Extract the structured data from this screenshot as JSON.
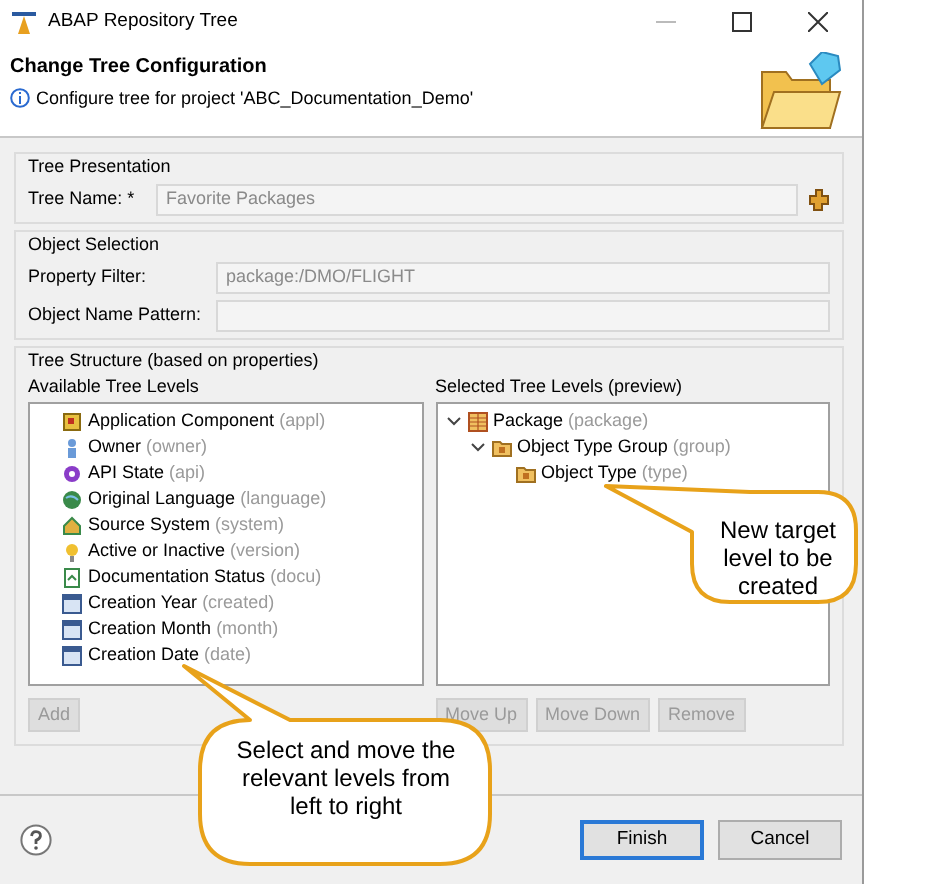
{
  "window": {
    "title": "ABAP Repository Tree"
  },
  "header": {
    "title": "Change Tree Configuration",
    "message": "Configure tree for project 'ABC_Documentation_Demo'"
  },
  "tree_presentation": {
    "legend": "Tree Presentation",
    "label": "Tree Name: *",
    "value": "Favorite Packages"
  },
  "object_selection": {
    "legend": "Object Selection",
    "fields": [
      {
        "label": "Property Filter:",
        "value": "package:/DMO/FLIGHT"
      },
      {
        "label": "Object Name Pattern:"
      }
    ]
  },
  "tree_structure": {
    "legend": "Tree Structure (based on properties)",
    "available": {
      "heading": "Available Tree Levels",
      "items": [
        {
          "name": "Application Component",
          "key": "(appl)"
        },
        {
          "name": "Owner",
          "key": "(owner)"
        },
        {
          "name": "API State",
          "key": "(api)"
        },
        {
          "name": "Original Language",
          "key": "(language)"
        },
        {
          "name": "Source System",
          "key": "(system)"
        },
        {
          "name": "Active or Inactive",
          "key": "(version)"
        },
        {
          "name": "Documentation Status",
          "key": "(docu)"
        },
        {
          "name": "Creation Year",
          "key": "(created)"
        },
        {
          "name": "Creation Month",
          "key": "(month)"
        },
        {
          "name": "Creation Date",
          "key": "(date)"
        }
      ]
    },
    "selected": {
      "heading": "Selected Tree Levels (preview)",
      "items": [
        {
          "name": "Package",
          "key": "(package)",
          "expanded": true,
          "children": [
            {
              "name": "Object Type Group",
              "key": "(group)",
              "expanded": true,
              "children": [
                {
                  "name": "Object Type",
                  "key": "(type)"
                }
              ]
            }
          ]
        }
      ]
    },
    "left_buttons": [
      {
        "label": "Add",
        "disabled": true
      }
    ],
    "right_buttons": [
      {
        "label": "Move Up",
        "disabled": true
      },
      {
        "label": "Move Down",
        "disabled": true
      },
      {
        "label": "Remove",
        "disabled": true
      }
    ]
  },
  "footer_buttons": [
    {
      "label": "Finish",
      "default": true
    },
    {
      "label": "Cancel",
      "default": false
    }
  ],
  "callouts": [
    {
      "text": "New target level to be created"
    },
    {
      "text": "Select and move the relevant levels from left to right"
    }
  ]
}
